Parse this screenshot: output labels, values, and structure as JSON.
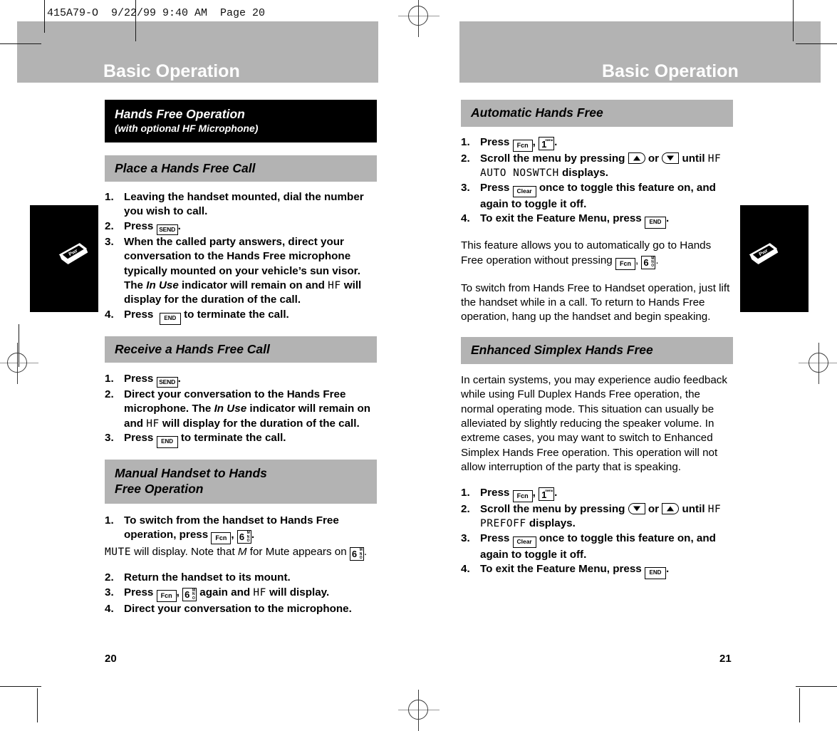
{
  "scan_header": {
    "text": "415A79-O  9/22/99 9:40 AM  Page 20"
  },
  "left_page": {
    "running_head": "Basic Operation",
    "page_number": "20",
    "section_black": {
      "title": "Hands Free Operation",
      "subtitle": "(with optional HF Microphone)"
    },
    "place_call": {
      "heading": "Place a Hands Free Call",
      "steps": [
        {
          "num": "1.",
          "text_before": "Leaving the handset mounted, dial the number you wish to call."
        },
        {
          "num": "2.",
          "text_before": "Press ",
          "key": "SEND",
          "text_after": "."
        },
        {
          "num": "3.",
          "text_before": "When the called party answers, direct your conversation to the Hands Free microphone typically mounted on your vehicle’s sun visor. The ",
          "italic": "In Use",
          "text_mid": " indicator will remain on and ",
          "lcd": "HF",
          "text_after": " will display for the duration of the call."
        },
        {
          "num": "4.",
          "text_before": "Press ",
          "key": "END",
          "text_after": " to terminate the call."
        }
      ]
    },
    "receive_call": {
      "heading": "Receive a Hands Free Call",
      "steps": [
        {
          "num": "1.",
          "text_before": "Press ",
          "key": "SEND",
          "text_after": "."
        },
        {
          "num": "2.",
          "text_before": "Direct your conversation to the Hands Free microphone. The ",
          "italic": "In Use",
          "text_mid": " indicator will remain on and ",
          "lcd": "HF",
          "text_after": " will display for the duration of the call."
        },
        {
          "num": "3.",
          "text_before": "Press ",
          "key": "END",
          "text_after": " to terminate the call."
        }
      ]
    },
    "manual_handset": {
      "heading_line1": "Manual Handset to Hands",
      "heading_line2": "Free Operation",
      "step1": {
        "num": "1.",
        "text_before": "To switch from the handset to Hands Free operation, press ",
        "key_fcn": "Fcn",
        "comma": ", ",
        "key_six_digit": "6",
        "key_six_sub": "MNO",
        "text_after": "."
      },
      "note": {
        "lcd": "MUTE",
        "text_before": " will display. Note that ",
        "italic": "M",
        "text_mid": " for Mute appears on ",
        "text_after": "."
      },
      "step2": {
        "num": "2.",
        "text": "Return the handset to its mount."
      },
      "step3": {
        "num": "3.",
        "text_before": "Press ",
        "key_fcn": "Fcn",
        "comma": ", ",
        "key_six_digit": "6",
        "key_six_sub": "MNO",
        "text_mid": " again and ",
        "lcd": "HF",
        "text_after": " will display."
      },
      "step4": {
        "num": "4.",
        "text": "Direct your conversation to the microphone."
      }
    }
  },
  "right_page": {
    "running_head": "Basic Operation",
    "page_number": "21",
    "automatic_hands_free": {
      "heading": "Automatic Hands Free",
      "step1": {
        "num": "1.",
        "text_before": "Press ",
        "key_fcn": "Fcn",
        "comma": ", ",
        "key_one_digit": "1",
        "key_one_sub": "menu",
        "text_after": "."
      },
      "step2": {
        "num": "2.",
        "text_before": "Scroll the menu by pressing ",
        "arrow_first": "up",
        "or": " or ",
        "arrow_second": "down",
        "text_mid": " until ",
        "lcd": "HF AUTO NOSWTCH",
        "text_after": " displays."
      },
      "step3": {
        "num": "3.",
        "text_before": "Press ",
        "key_clear": "Clear",
        "text_after": " once to toggle this feature on, and again to toggle it off."
      },
      "step4": {
        "num": "4.",
        "text_before": "To exit the Feature Menu, press ",
        "key_end": "END",
        "text_after": "."
      },
      "para1": {
        "text_before": "This feature allows you to automatically go to Hands Free operation without pressing ",
        "key_fcn": "Fcn",
        "comma": ", ",
        "key_six_digit": "6",
        "key_six_sub": "MNO",
        "text_after": "."
      },
      "para2": "To switch from Hands Free to Handset operation, just lift the handset while in a call. To return to Hands Free operation, hang up the handset and begin speaking."
    },
    "enhanced_simplex": {
      "heading": "Enhanced Simplex Hands Free",
      "para": "In certain systems, you may experience audio feedback while using Full Duplex Hands Free operation, the normal operating mode. This situation can usually be alleviated by slightly reducing the speaker volume. In extreme cases, you may want to switch to Enhanced Simplex Hands Free operation. This operation will not allow interruption of the party that is speaking.",
      "step1": {
        "num": "1.",
        "text_before": "Press ",
        "key_fcn": "Fcn",
        "comma": ", ",
        "key_one_digit": "1",
        "key_one_sub": "menu",
        "text_after": "."
      },
      "step2": {
        "num": "2.",
        "text_before": "Scroll the menu by pressing ",
        "arrow_first": "down",
        "or": " or ",
        "arrow_second": "up",
        "text_mid": " until ",
        "lcd": "HF PREFOFF",
        "text_after": " displays."
      },
      "step3": {
        "num": "3.",
        "text_before": "Press ",
        "key_clear": "Clear",
        "text_after": " once to toggle this feature on, and again to toggle it off."
      },
      "step4": {
        "num": "4.",
        "text_before": "To exit the Feature Menu, press ",
        "key_end": "END",
        "text_after": "."
      }
    }
  },
  "side_tabs": {
    "left_icon": "phone-key-icon",
    "right_icon": "phone-key-icon"
  },
  "colors": {
    "band_gray": "#b3b3b3",
    "black": "#000000",
    "white": "#ffffff"
  }
}
